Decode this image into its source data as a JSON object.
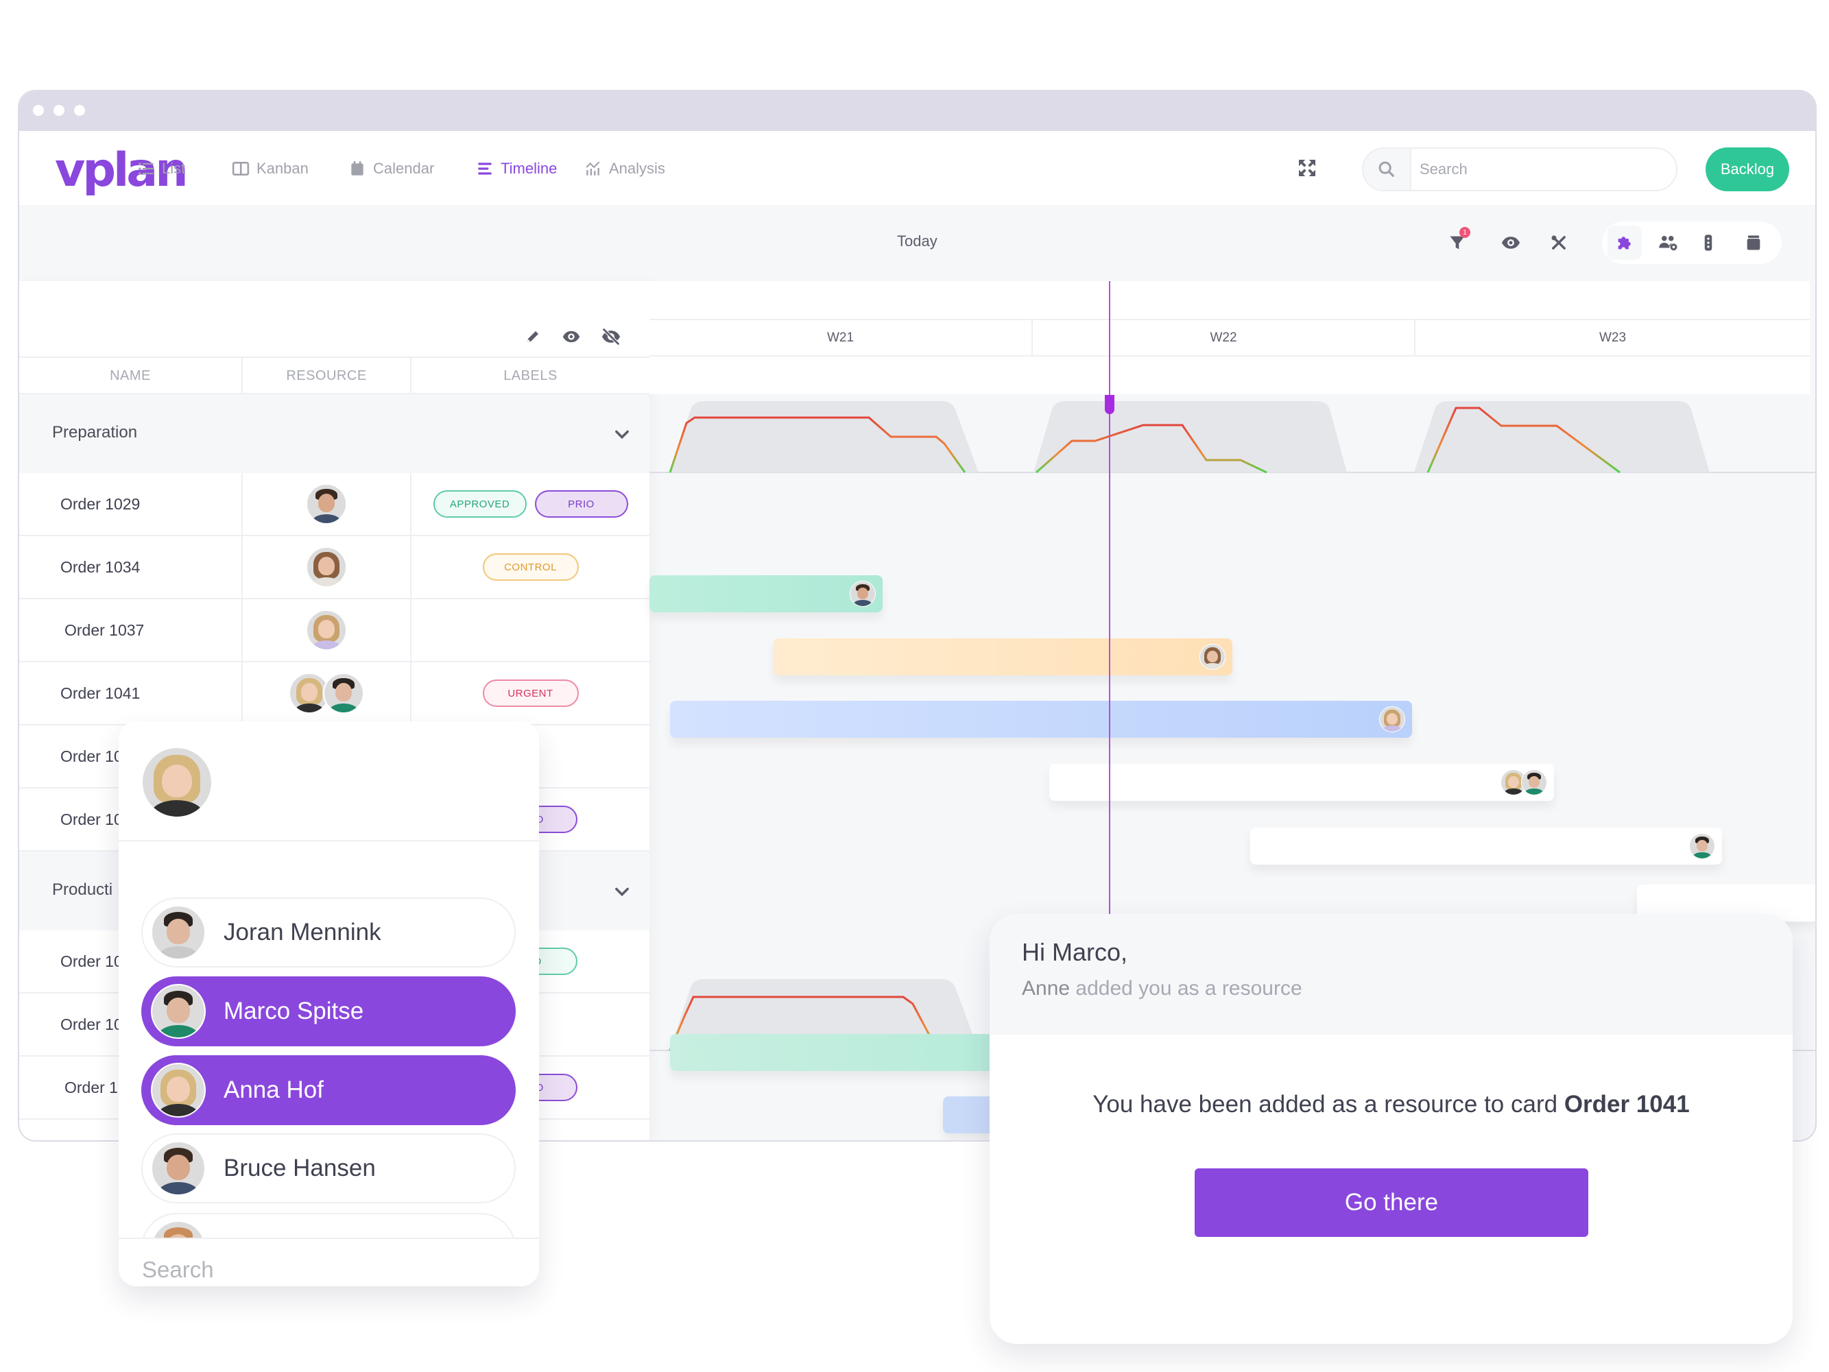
{
  "app": {
    "logo": "vplan",
    "brand_color": "#8a47dd"
  },
  "nav": [
    {
      "label": "List",
      "icon": "list-icon",
      "active": false
    },
    {
      "label": "Kanban",
      "icon": "kanban-icon",
      "active": false
    },
    {
      "label": "Calendar",
      "icon": "calendar-icon",
      "active": false
    },
    {
      "label": "Timeline",
      "icon": "timeline-icon",
      "active": true
    },
    {
      "label": "Analysis",
      "icon": "analysis-icon",
      "active": false
    }
  ],
  "header": {
    "search_placeholder": "Search",
    "backlog_label": "Backlog",
    "backlog_color": "#2fc797"
  },
  "toolbar": {
    "today_label": "Today",
    "filter_badge": "1"
  },
  "table": {
    "columns": [
      "NAME",
      "RESOURCE",
      "LABELS"
    ],
    "groups": [
      {
        "label": "Preparation",
        "rows": [
          {
            "name": "Order 1029",
            "resources": [
              "Bruce Hansen"
            ],
            "labels": [
              "APPROVED",
              "PRIO"
            ]
          },
          {
            "name": "Order 1034",
            "resources": [
              "Resource"
            ],
            "labels": [
              "CONTROL"
            ]
          },
          {
            "name": "Order 1037",
            "resources": [
              "Resource"
            ],
            "labels": []
          },
          {
            "name": "Order 1041",
            "resources": [
              "Anna Hof",
              "Marco Spitse"
            ],
            "labels": [
              "URGENT"
            ]
          },
          {
            "name": "Order 10",
            "resources": [],
            "labels": []
          },
          {
            "name": "Order 10",
            "resources": [],
            "labels": [
              "PRIO"
            ]
          }
        ]
      },
      {
        "label": "Producti",
        "rows": [
          {
            "name": "Order 10",
            "resources": [],
            "labels": [
              "VED"
            ]
          },
          {
            "name": "Order 10",
            "resources": [],
            "labels": []
          },
          {
            "name": "Order 1",
            "resources": [],
            "labels": [
              "PRIO"
            ]
          }
        ]
      }
    ]
  },
  "timeline": {
    "weeks": [
      "W21",
      "W22",
      "W23"
    ],
    "today_marker_color": "#a72be0"
  },
  "picker": {
    "people": [
      {
        "name": "Joran Mennink",
        "selected": false
      },
      {
        "name": "Marco Spitse",
        "selected": true
      },
      {
        "name": "Anna Hof",
        "selected": true
      },
      {
        "name": "Bruce Hansen",
        "selected": false
      }
    ],
    "search_placeholder": "Search"
  },
  "notification": {
    "greeting": "Hi Marco,",
    "subtitle_actor": "Anne",
    "subtitle_rest": " added you as a resource",
    "message": "You have been added as a resource to card ",
    "card": "Order 1041",
    "button_label": "Go there"
  }
}
